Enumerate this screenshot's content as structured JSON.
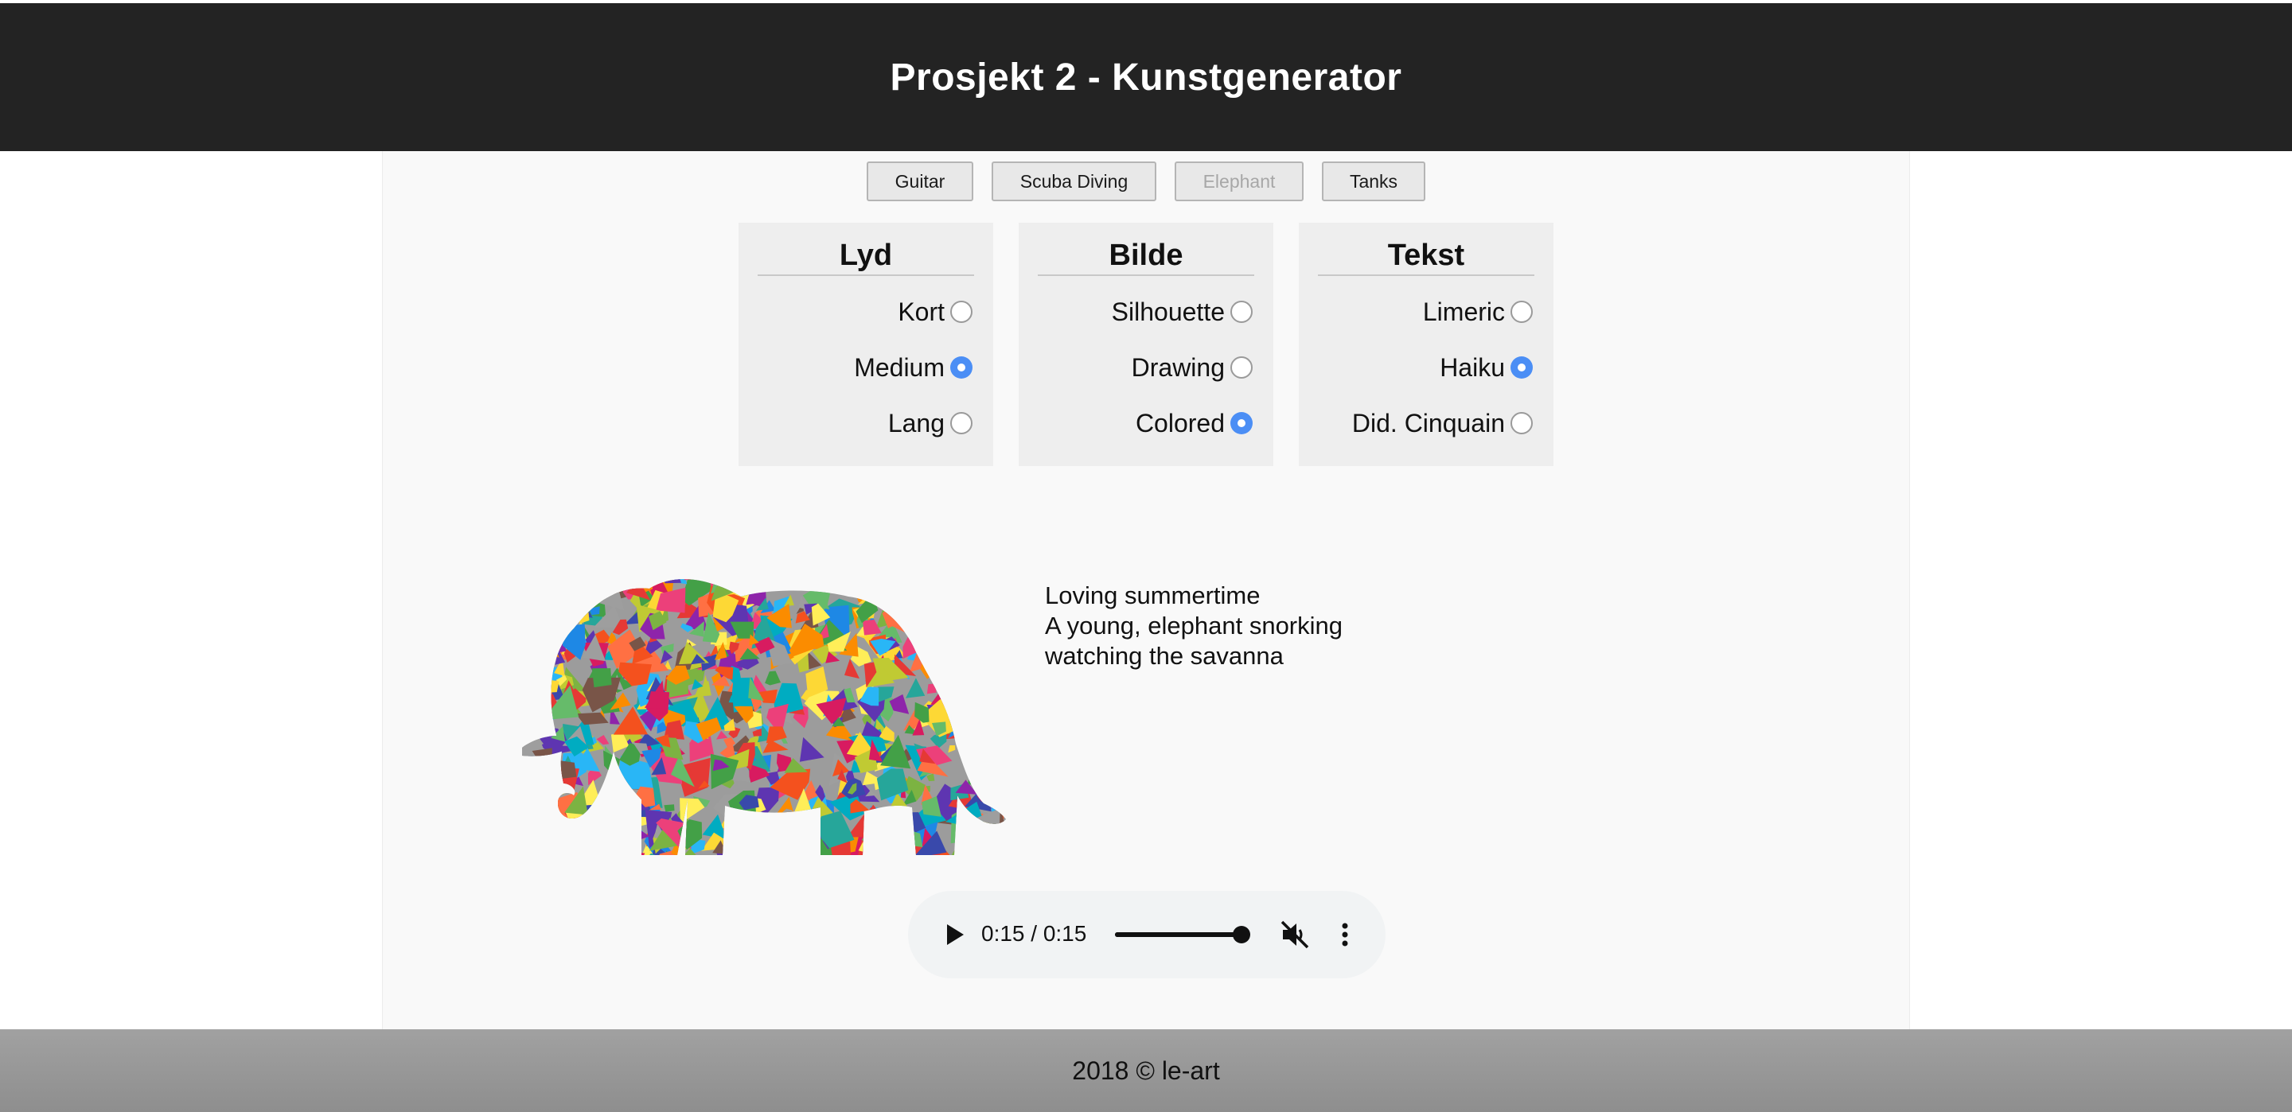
{
  "header": {
    "title": "Prosjekt 2 - Kunstgenerator"
  },
  "tabs": [
    {
      "label": "Guitar",
      "disabled": false
    },
    {
      "label": "Scuba Diving",
      "disabled": false
    },
    {
      "label": "Elephant",
      "disabled": true
    },
    {
      "label": "Tanks",
      "disabled": false
    }
  ],
  "panels": {
    "lyd": {
      "title": "Lyd",
      "options": [
        {
          "label": "Kort",
          "checked": false
        },
        {
          "label": "Medium",
          "checked": true
        },
        {
          "label": "Lang",
          "checked": false
        }
      ]
    },
    "bilde": {
      "title": "Bilde",
      "options": [
        {
          "label": "Silhouette",
          "checked": false
        },
        {
          "label": "Drawing",
          "checked": false
        },
        {
          "label": "Colored",
          "checked": true
        }
      ]
    },
    "tekst": {
      "title": "Tekst",
      "options": [
        {
          "label": "Limeric",
          "checked": false
        },
        {
          "label": "Haiku",
          "checked": true
        },
        {
          "label": "Did. Cinquain",
          "checked": false
        }
      ]
    }
  },
  "artwork": {
    "icon": "colored-elephant-mosaic"
  },
  "poem": {
    "lines": [
      "Loving summertime",
      "A young, elephant snorking",
      "watching the savanna"
    ]
  },
  "audio": {
    "time": "0:15 / 0:15",
    "progress": 1.0,
    "muted": true,
    "icons": {
      "play": "play-icon",
      "mute": "muted-speaker-icon",
      "more": "more-vertical-icon"
    }
  },
  "footer": {
    "text": "2018 © le-art"
  },
  "colors": {
    "header_bg": "#232323",
    "accent_radio": "#4b8ef5",
    "footer_bg": "#959595"
  }
}
